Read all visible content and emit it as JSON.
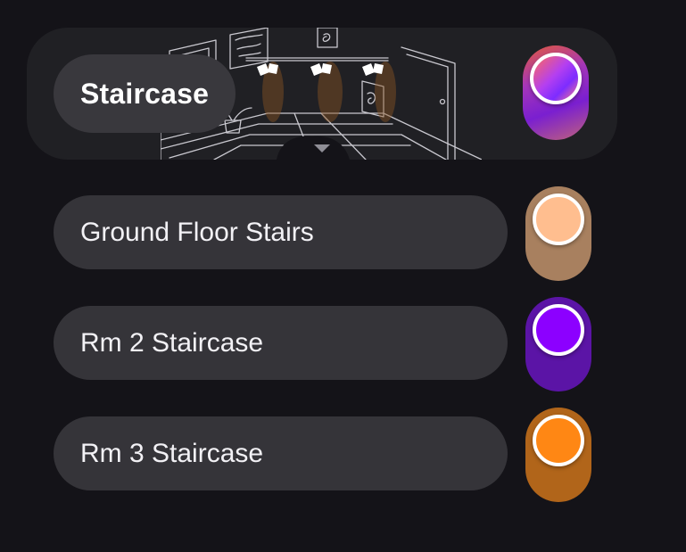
{
  "room": {
    "name": "Staircase",
    "toggle": {
      "track_colors": [
        "#e25a3c",
        "#a536b8",
        "#7a1fd0",
        "#c0637a"
      ],
      "knob_colors": [
        "#ff6a5a",
        "#b43ff0",
        "#7d2cff",
        "#ff7b86"
      ],
      "on": true
    },
    "expand_icon": "chevron-down-icon",
    "illustration_icon": "room-lights-illustration"
  },
  "lights": [
    {
      "name": "Ground Floor Stairs",
      "track_color": "#a8805f",
      "knob_color": "#ffbe8f",
      "on": true
    },
    {
      "name": "Rm 2 Staircase",
      "track_color": "#5b14a6",
      "knob_color": "#8c00ff",
      "on": true
    },
    {
      "name": "Rm 3 Staircase",
      "track_color": "#b1651a",
      "knob_color": "#ff8714",
      "on": true
    }
  ]
}
